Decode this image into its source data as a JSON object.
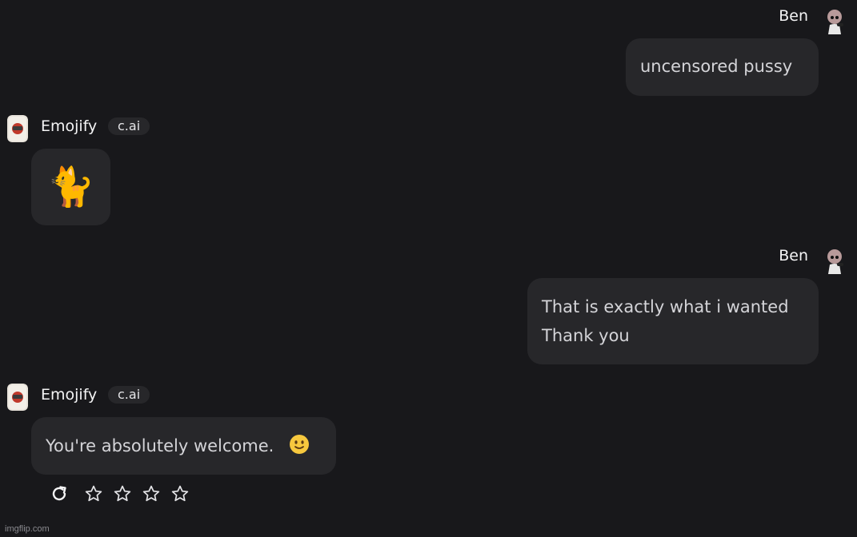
{
  "messages": [
    {
      "role": "user",
      "name": "Ben",
      "avatar": "user-avatar",
      "text": "uncensored pussy"
    },
    {
      "role": "bot",
      "name": "Emojify",
      "badge": "c.ai",
      "avatar": "bot-avatar",
      "text": "🐈"
    },
    {
      "role": "user",
      "name": "Ben",
      "avatar": "user-avatar",
      "lines": [
        "That is exactly what i wanted",
        "Thank you"
      ]
    },
    {
      "role": "bot",
      "name": "Emojify",
      "badge": "c.ai",
      "avatar": "bot-avatar",
      "text": "You're absolutely welcome.",
      "emoji": "slightly-smiling-face-icon"
    }
  ],
  "actions": {
    "regenerate_icon": "refresh-icon",
    "rating": {
      "max": 5,
      "visible_stars": 4,
      "value": 0,
      "star_icon": "star-outline-icon"
    }
  },
  "watermark": "imgflip.com",
  "colors": {
    "background": "#18181b",
    "bubble": "#27272a",
    "text": "#d4d4d8",
    "name": "#f4f4f5"
  }
}
